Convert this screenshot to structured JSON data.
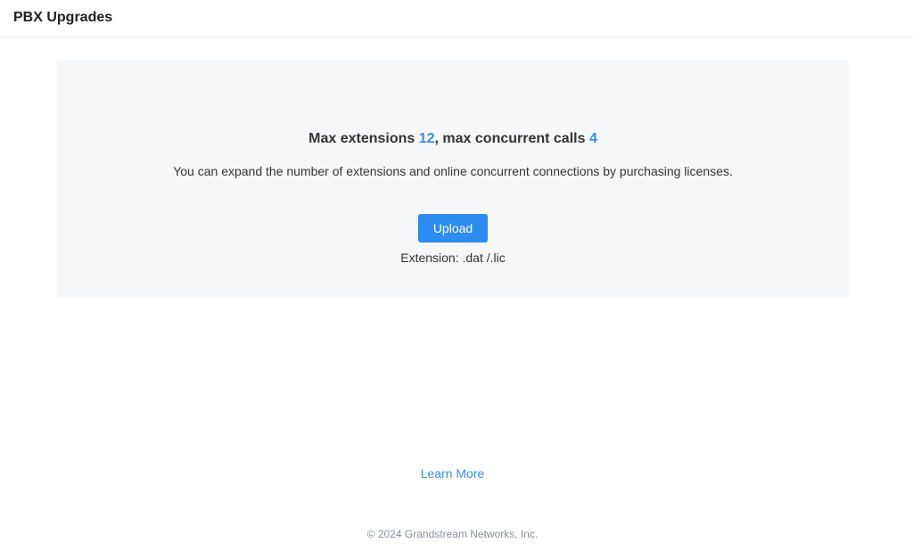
{
  "header": {
    "title": "PBX Upgrades"
  },
  "license": {
    "max_extensions_label": "Max extensions",
    "max_extensions_value": "12",
    "separator": ", ",
    "max_calls_label": "max concurrent calls",
    "max_calls_value": "4",
    "description": "You can expand the number of extensions and online concurrent connections by purchasing licenses.",
    "upload_label": "Upload",
    "extension_hint": "Extension: .dat /.lic"
  },
  "links": {
    "learn_more": "Learn More"
  },
  "footer": {
    "copyright": "© 2024 Grandstream Networks, Inc."
  },
  "colors": {
    "accent": "#2d8cf0",
    "link": "#3a8ee6",
    "panel_bg": "#f5f7f9"
  }
}
